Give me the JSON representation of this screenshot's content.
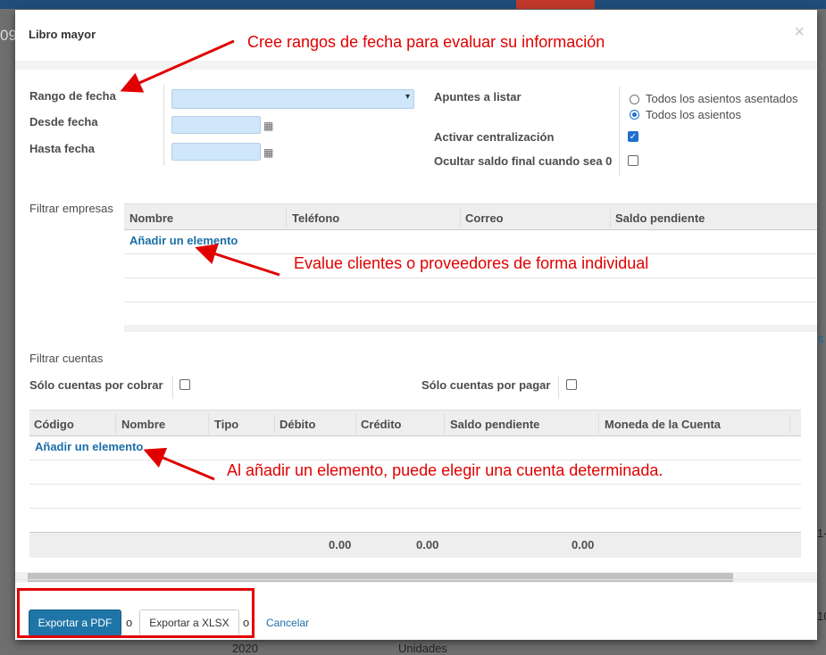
{
  "background": {
    "left_text": "09",
    "right_text_1": "s",
    "right_text_2": "1-",
    "right_text_3": "10",
    "bottom_year": "2020",
    "bottom_units": "Unidades"
  },
  "modal": {
    "title": "Libro mayor",
    "close_icon": "×"
  },
  "form": {
    "date_range_label": "Rango de fecha",
    "date_range_caret": "▾",
    "from_date_label": "Desde fecha",
    "to_date_label": "Hasta fecha",
    "calendar_icon": "▦",
    "moves_label": "Apuntes a listar",
    "radio_posted": "Todos los asientos asentados",
    "radio_all": "Todos los asientos",
    "centralize_label": "Activar centralización",
    "checkmark": "✓",
    "hide_zero_label": "Ocultar saldo final cuando sea 0"
  },
  "partners": {
    "section_label": "Filtrar empresas",
    "columns": [
      "Nombre",
      "Teléfono",
      "Correo",
      "Saldo pendiente"
    ],
    "add_link": "Añadir un elemento"
  },
  "accounts": {
    "section_label": "Filtrar cuentas",
    "receivable_label": "Sólo cuentas por cobrar",
    "payable_label": "Sólo cuentas por pagar",
    "columns": [
      "Código",
      "Nombre",
      "Tipo",
      "Débito",
      "Crédito",
      "Saldo pendiente",
      "Moneda de la Cuenta"
    ],
    "add_link": "Añadir un elemento",
    "totals": {
      "debit": "0.00",
      "credit": "0.00",
      "balance": "0.00"
    }
  },
  "footer": {
    "export_pdf": "Exportar a PDF",
    "or_1": "o",
    "export_xlsx": "Exportar a XLSX",
    "or_2": "o",
    "cancel": "Cancelar"
  },
  "annotations": {
    "date_note": "Cree rangos de fecha para evaluar su información",
    "partner_note": "Evalue clientes o proveedores de forma individual",
    "account_note": "Al añadir un elemento, puede elegir una cuenta determinada.",
    "color": "#e00000"
  },
  "colors": {
    "primary": "#1f75a8",
    "input_bg": "#cfe6fb",
    "link": "#1a6fa8"
  }
}
